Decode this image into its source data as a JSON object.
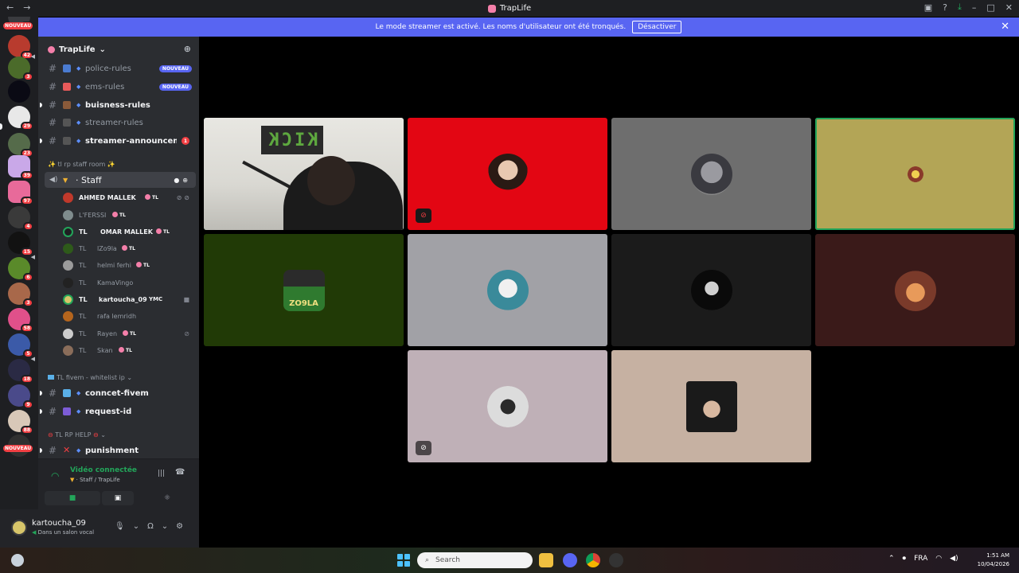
{
  "window": {
    "title": "TrapLife"
  },
  "banner": {
    "text": "Le mode streamer est activé. Les noms d'utilisateur ont été tronqués.",
    "button": "Désactiver"
  },
  "rail": {
    "badges": [
      "24",
      "42",
      "3",
      "29",
      "23",
      "39",
      "97",
      "4",
      "15",
      "6",
      "3",
      "58",
      "5",
      "18",
      "9",
      "88"
    ],
    "new_label": "NOUVEAU"
  },
  "guild": {
    "name": "TrapLife"
  },
  "channels": [
    {
      "name": "police-rules",
      "tag": "NOUVEAU"
    },
    {
      "name": "ems-rules",
      "tag": "NOUVEAU"
    },
    {
      "name": "buisness-rules"
    },
    {
      "name": "streamer-rules"
    },
    {
      "name": "streamer-announcem...",
      "count": "1"
    }
  ],
  "categories": {
    "staff_room": "✨ tl rp staff room ✨",
    "fivem": "TL fivem - whitelist ip",
    "help": "TL RP HELP"
  },
  "voice_channel": {
    "name": "· Staff"
  },
  "members": [
    {
      "name": "AHMED MALLEK",
      "tag": "TL",
      "color": "#c0392b"
    },
    {
      "name": "L'FERSSI",
      "tag": "TL",
      "color": "#7f8c8d"
    },
    {
      "prefix": "TL",
      "name": "OMAR MALLEK",
      "tag": "TL",
      "color": "#1e1f22"
    },
    {
      "prefix": "TL",
      "name": "lZo9la",
      "tag": "TL",
      "color": "#2e5a1a"
    },
    {
      "prefix": "TL",
      "name": "helmi ferhi",
      "tag": "TL",
      "color": "#9b9b9b"
    },
    {
      "prefix": "TL",
      "name": "KamaVingo",
      "color": "#222"
    },
    {
      "prefix": "TL",
      "name": "kartoucha_09",
      "tag": "YMC",
      "color": "#d7c56a"
    },
    {
      "prefix": "TL",
      "name": "rafa lemridh",
      "color": "#b5651d"
    },
    {
      "prefix": "TL",
      "name": "Rayen",
      "tag": "TL",
      "color": "#ccc"
    },
    {
      "prefix": "TL",
      "name": "Skan",
      "tag": "TL",
      "color": "#8a6d5a"
    }
  ],
  "fivem_channels": [
    {
      "name": "conncet-fivem"
    },
    {
      "name": "request-id"
    }
  ],
  "help_channels": [
    {
      "name": "punishment"
    }
  ],
  "voice_panel": {
    "status": "Vidéo connectée",
    "location": "Staff / TrapLife"
  },
  "user_panel": {
    "name": "kartoucha_09",
    "status": "Dans un salon vocal"
  },
  "video_tiles": [
    {
      "kind": "camera",
      "sign": "KICK",
      "speaking": true
    },
    {
      "bg": "#e30613",
      "muted": "red"
    },
    {
      "bg": "#6e6e6e"
    },
    {
      "bg": "#b3a556",
      "speaking": true
    },
    {
      "bg": "#213a06",
      "avatar_text": "ZO9LA"
    },
    {
      "bg": "#a1a1a6"
    },
    {
      "bg": "#1b1b1b"
    },
    {
      "bg": "#3a1a19"
    },
    {
      "bg": "#bfb0b7",
      "muted": "grey"
    },
    {
      "bg": "#c6b1a2"
    }
  ],
  "taskbar": {
    "search": "Search",
    "lang": "FRA",
    "time": "1:51 AM",
    "date": "10/04/2026"
  },
  "colors": {
    "accent": "#5865f2",
    "online": "#23a55a",
    "danger": "#f23f43"
  }
}
